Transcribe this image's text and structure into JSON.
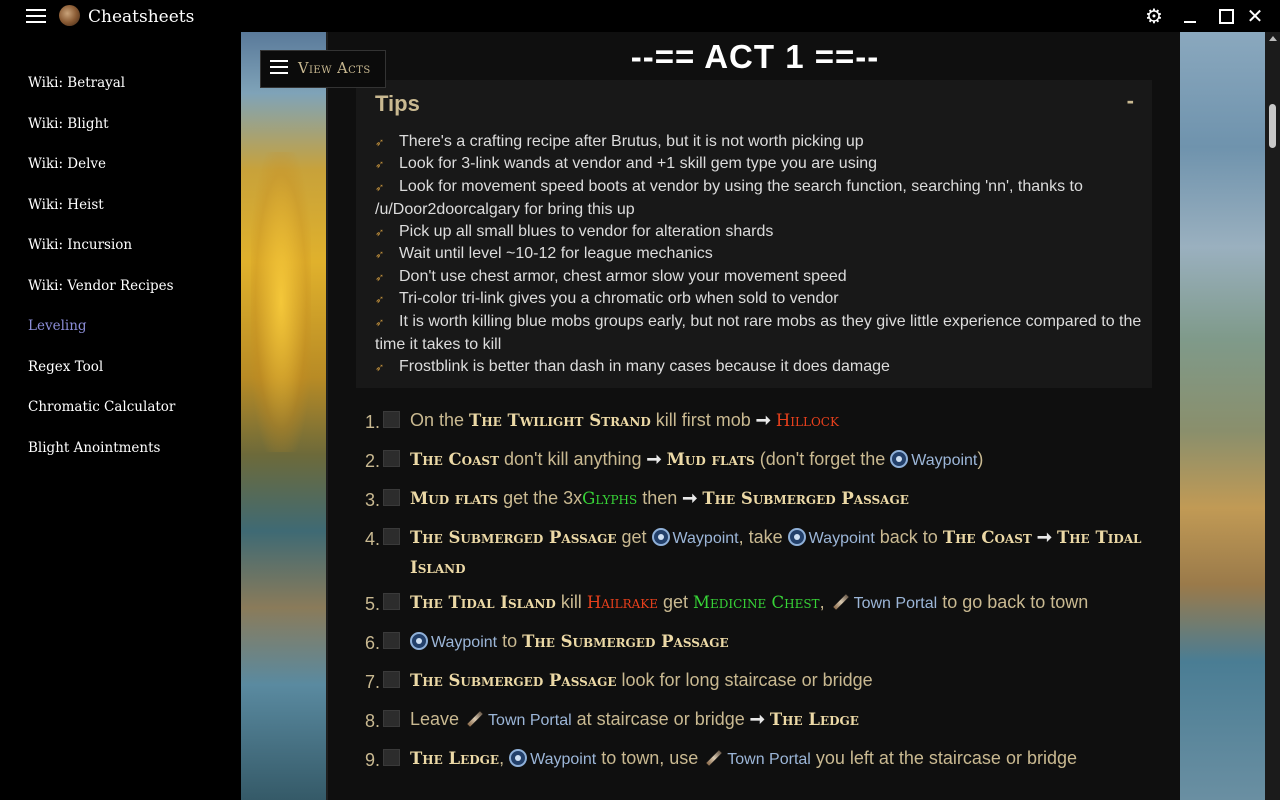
{
  "app": {
    "title": "Cheatsheets"
  },
  "sidebar": {
    "items": [
      {
        "label": "Wiki: Betrayal",
        "active": false
      },
      {
        "label": "Wiki: Blight",
        "active": false
      },
      {
        "label": "Wiki: Delve",
        "active": false
      },
      {
        "label": "Wiki: Heist",
        "active": false
      },
      {
        "label": "Wiki: Incursion",
        "active": false
      },
      {
        "label": "Wiki: Vendor Recipes",
        "active": false
      },
      {
        "label": "Leveling",
        "active": true
      },
      {
        "label": "Regex Tool",
        "active": false
      },
      {
        "label": "Chromatic Calculator",
        "active": false
      },
      {
        "label": "Blight Anointments",
        "active": false
      }
    ]
  },
  "main": {
    "view_acts_label": "View Acts",
    "act_title": "--== ACT 1 ==--",
    "tips": {
      "header": "Tips",
      "collapse_symbol": "-",
      "items": [
        "There's a crafting recipe after Brutus, but it is not worth picking up",
        "Look for 3-link wands at vendor and +1 skill gem type you are using",
        "Look for movement speed boots at vendor by using the search function, searching 'nn', thanks to /u/Door2doorcalgary for bring this up",
        "Pick up all small blues to vendor for alteration shards",
        "Wait until level ~10-12 for league mechanics",
        "Don't use chest armor, chest armor slow your movement speed",
        "Tri-color tri-link gives you a chromatic orb when sold to vendor",
        "It is worth killing blue mobs groups early, but not rare mobs as they give little experience compared to the time it takes to kill",
        "Frostblink is better than dash in many cases because it does damage"
      ]
    },
    "steps": [
      {
        "num": "1.",
        "parts": [
          {
            "t": "text",
            "v": "On the "
          },
          {
            "t": "loc",
            "v": "The Twilight Strand"
          },
          {
            "t": "text",
            "v": " kill first mob "
          },
          {
            "t": "arrow",
            "v": "➞"
          },
          {
            "t": "text",
            "v": " "
          },
          {
            "t": "boss",
            "v": "Hillock"
          }
        ]
      },
      {
        "num": "2.",
        "parts": [
          {
            "t": "loc",
            "v": "The Coast"
          },
          {
            "t": "text",
            "v": " don't kill anything "
          },
          {
            "t": "arrow",
            "v": "➞"
          },
          {
            "t": "text",
            "v": " "
          },
          {
            "t": "loc",
            "v": "Mud flats"
          },
          {
            "t": "text",
            "v": " (don't forget the "
          },
          {
            "t": "wp",
            "v": "Waypoint"
          },
          {
            "t": "text",
            "v": ")"
          }
        ]
      },
      {
        "num": "3.",
        "parts": [
          {
            "t": "loc",
            "v": "Mud flats"
          },
          {
            "t": "text",
            "v": " get the 3x"
          },
          {
            "t": "quest",
            "v": "Glyphs"
          },
          {
            "t": "text",
            "v": " then "
          },
          {
            "t": "arrow",
            "v": "➞"
          },
          {
            "t": "text",
            "v": " "
          },
          {
            "t": "loc",
            "v": "The Submerged Passage"
          }
        ]
      },
      {
        "num": "4.",
        "parts": [
          {
            "t": "loc",
            "v": "The Submerged Passage"
          },
          {
            "t": "text",
            "v": " get "
          },
          {
            "t": "wp",
            "v": "Waypoint"
          },
          {
            "t": "text",
            "v": ", take "
          },
          {
            "t": "wp",
            "v": "Waypoint"
          },
          {
            "t": "text",
            "v": " back to "
          },
          {
            "t": "loc",
            "v": "The Coast"
          },
          {
            "t": "text",
            "v": " "
          },
          {
            "t": "arrow",
            "v": "➞"
          },
          {
            "t": "text",
            "v": " "
          },
          {
            "t": "loc",
            "v": "The Tidal Island"
          }
        ]
      },
      {
        "num": "5.",
        "parts": [
          {
            "t": "loc",
            "v": "The Tidal Island"
          },
          {
            "t": "text",
            "v": " kill "
          },
          {
            "t": "boss",
            "v": "Hailrake"
          },
          {
            "t": "text",
            "v": " get "
          },
          {
            "t": "quest",
            "v": "Medicine Chest"
          },
          {
            "t": "text",
            "v": ", "
          },
          {
            "t": "tp",
            "v": "Town Portal"
          },
          {
            "t": "text",
            "v": " to go back to town"
          }
        ]
      },
      {
        "num": "6.",
        "parts": [
          {
            "t": "wp",
            "v": "Waypoint"
          },
          {
            "t": "text",
            "v": " to "
          },
          {
            "t": "loc",
            "v": "The Submerged Passage"
          }
        ]
      },
      {
        "num": "7.",
        "parts": [
          {
            "t": "loc",
            "v": "The Submerged Passage"
          },
          {
            "t": "text",
            "v": " look for long staircase or bridge"
          }
        ]
      },
      {
        "num": "8.",
        "parts": [
          {
            "t": "text",
            "v": "Leave "
          },
          {
            "t": "tp",
            "v": "Town Portal"
          },
          {
            "t": "text",
            "v": " at staircase or bridge "
          },
          {
            "t": "arrow",
            "v": "➞"
          },
          {
            "t": "text",
            "v": " "
          },
          {
            "t": "loc",
            "v": "The Ledge"
          }
        ]
      },
      {
        "num": "9.",
        "parts": [
          {
            "t": "loc",
            "v": "The Ledge"
          },
          {
            "t": "text",
            "v": ", "
          },
          {
            "t": "wp",
            "v": "Waypoint"
          },
          {
            "t": "text",
            "v": " to town, use "
          },
          {
            "t": "tp",
            "v": "Town Portal"
          },
          {
            "t": "text",
            "v": " you left at the staircase or bridge"
          }
        ]
      }
    ]
  },
  "colors": {
    "location": "#ecd9a6",
    "boss": "#e8401c",
    "quest_item": "#37d437",
    "waypoint": "#9cb6d8",
    "sidebar_active": "#8c8ed8",
    "text_muted_gold": "#c9b991"
  },
  "icons": {
    "menu": "hamburger-icon",
    "settings": "gear-icon",
    "waypoint": "waypoint-icon",
    "town_portal": "town-portal-scroll-icon",
    "tip_bullet": "arrow-bullet-icon"
  }
}
